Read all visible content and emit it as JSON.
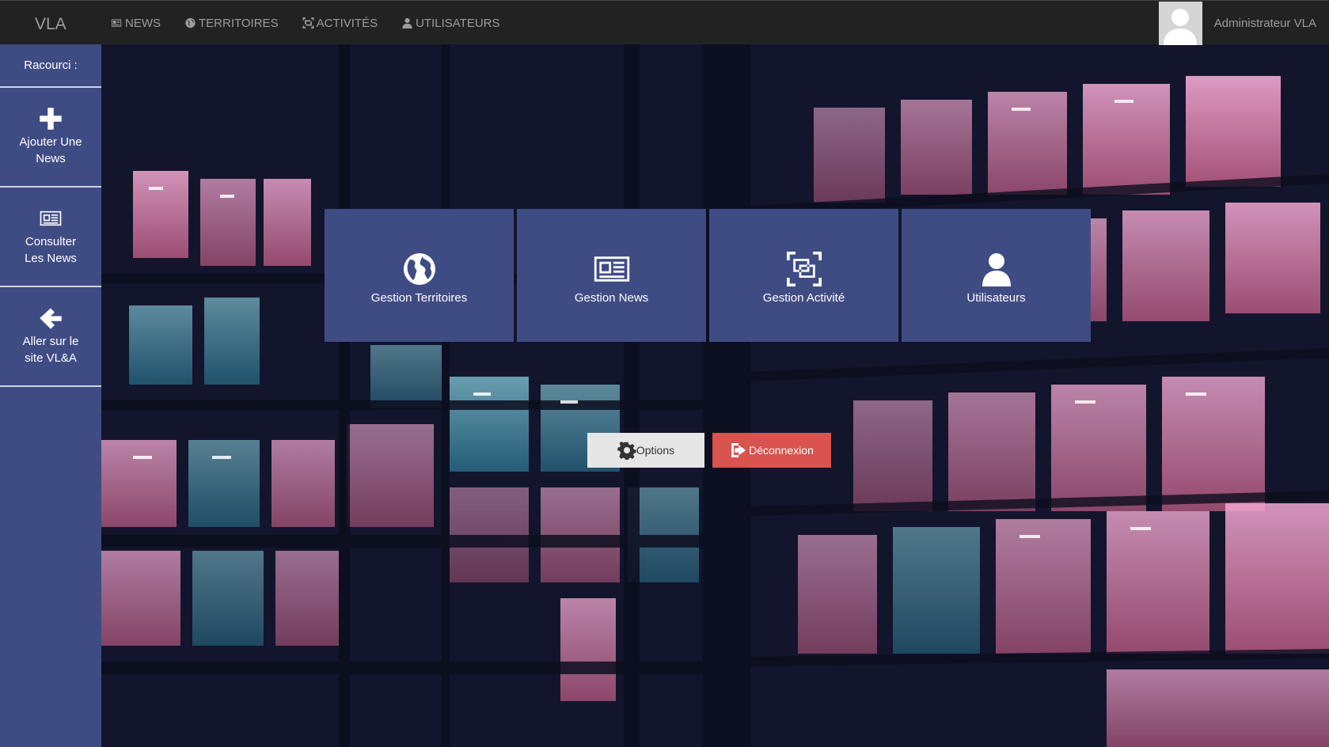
{
  "app": {
    "brand": "VLA"
  },
  "nav": {
    "items": [
      {
        "label": "NEWS",
        "icon": "newspaper-icon"
      },
      {
        "label": "TERRITOIRES",
        "icon": "globe-icon"
      },
      {
        "label": "ACTIVITÉS",
        "icon": "screenshot-icon"
      },
      {
        "label": "UTILISATEURS",
        "icon": "user-icon"
      }
    ],
    "user_name": "Administrateur VLA"
  },
  "sidebar": {
    "header": "Racourci :",
    "items": [
      {
        "line1": "Ajouter Une",
        "line2": "News",
        "icon": "plus-icon"
      },
      {
        "line1": "Consulter",
        "line2": "Les News",
        "icon": "newspaper-icon"
      },
      {
        "line1": "Aller sur le",
        "line2": "site VL&A",
        "icon": "arrow-left-icon"
      }
    ]
  },
  "tiles": [
    {
      "label": "Gestion Territoires",
      "icon": "globe-icon"
    },
    {
      "label": "Gestion News",
      "icon": "newspaper-icon"
    },
    {
      "label": "Gestion Activité",
      "icon": "screenshot-icon"
    },
    {
      "label": "Utilisateurs",
      "icon": "user-icon"
    }
  ],
  "actions": {
    "options_label": "Options",
    "logout_label": "Déconnexion"
  },
  "colors": {
    "navbar": "#222222",
    "primary": "#3f4c84",
    "danger": "#d9534f",
    "options_bg": "#e6e6e6"
  }
}
